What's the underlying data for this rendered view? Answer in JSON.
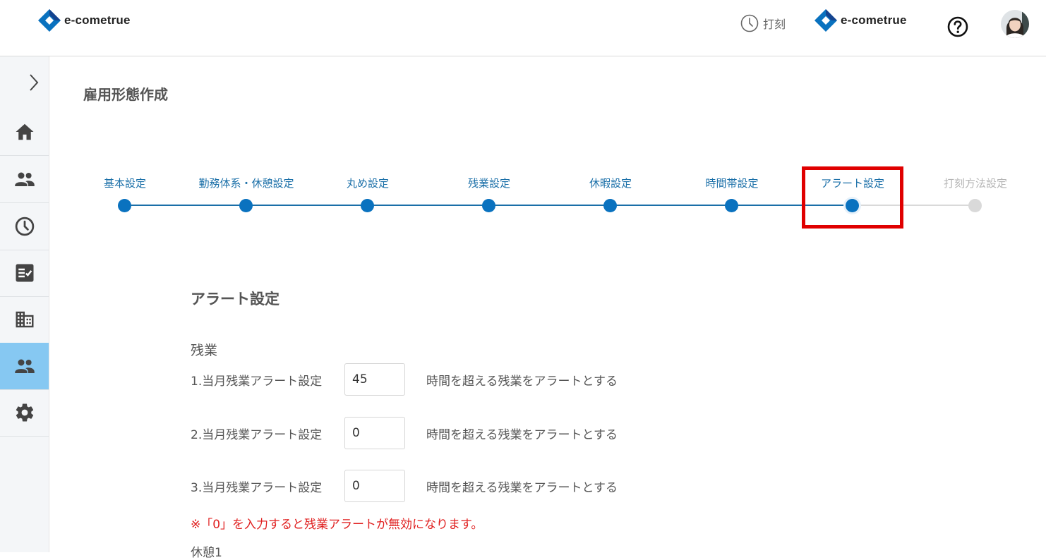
{
  "header": {
    "logo_text": "e-cometrue",
    "punch_label": "打刻",
    "brand_colors": {
      "blue": "#0a72bf",
      "dark_blue": "#14438f"
    }
  },
  "sidebar": {
    "active_bg": "#86c8f2",
    "items": [
      {
        "icon": "home-icon"
      },
      {
        "icon": "people-icon"
      },
      {
        "icon": "clock-icon"
      },
      {
        "icon": "checklist-icon"
      },
      {
        "icon": "building-icon"
      },
      {
        "icon": "people-icon",
        "active": true
      },
      {
        "icon": "gear-icon"
      }
    ]
  },
  "page": {
    "title": "雇用形態作成"
  },
  "stepper": {
    "active_color": "#0a72bf",
    "inactive_color": "#d9d9d9",
    "steps": [
      {
        "label": "基本設定",
        "state": "done"
      },
      {
        "label": "勤務体系・休憩設定",
        "state": "done"
      },
      {
        "label": "丸め設定",
        "state": "done"
      },
      {
        "label": "残業設定",
        "state": "done"
      },
      {
        "label": "休暇設定",
        "state": "done"
      },
      {
        "label": "時間帯設定",
        "state": "done"
      },
      {
        "label": "アラート設定",
        "state": "current"
      },
      {
        "label": "打刻方法設定",
        "state": "inactive"
      }
    ]
  },
  "form": {
    "section_title": "アラート設定",
    "overtime": {
      "title": "残業",
      "rows": [
        {
          "label": "1.当月残業アラート設定",
          "value": "45",
          "suffix": "時間を超える残業をアラートとする"
        },
        {
          "label": "2.当月残業アラート設定",
          "value": "0",
          "suffix": "時間を超える残業をアラートとする"
        },
        {
          "label": "3.当月残業アラート設定",
          "value": "0",
          "suffix": "時間を超える残業をアラートとする"
        }
      ],
      "note": "※「0」を入力すると残業アラートが無効になります。"
    },
    "next_label": "休憩1"
  }
}
